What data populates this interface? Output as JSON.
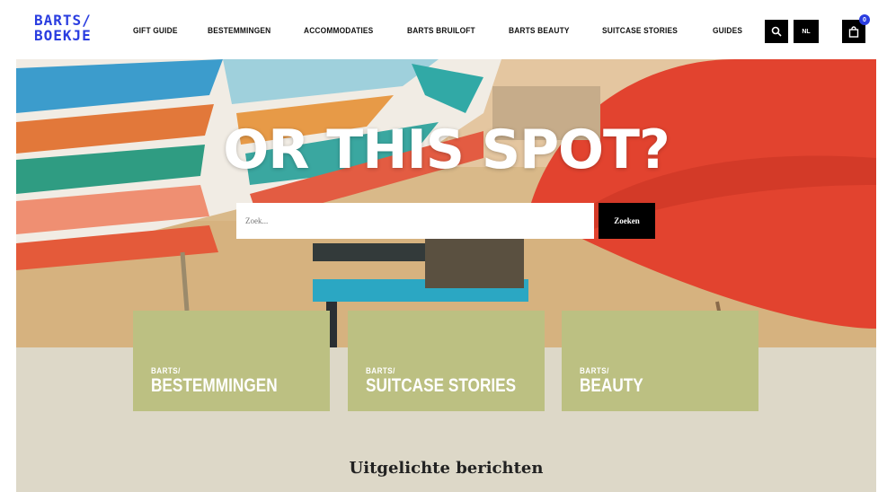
{
  "logo": {
    "line1": "BARTS/",
    "line2": "BOEKJE"
  },
  "nav": {
    "items": [
      "GIFT GUIDE",
      "BESTEMMINGEN",
      "ACCOMMODATIES",
      "BARTS BRUILOFT",
      "BARTS BEAUTY",
      "SUITCASE STORIES",
      "GUIDES"
    ],
    "lang_label": "NL",
    "cart_count": "0",
    "icons": {
      "search": "search-icon",
      "cart": "bag-icon"
    }
  },
  "hero": {
    "title": "OR THIS SPOT?",
    "search_placeholder": "Zoek...",
    "search_button": "Zoeken"
  },
  "tiles": [
    {
      "small": "BARTS/",
      "big": "BESTEMMINGEN"
    },
    {
      "small": "BARTS/",
      "big": "SUITCASE STORIES"
    },
    {
      "small": "BARTS/",
      "big": "BEAUTY"
    }
  ],
  "featured_heading": "Uitgelichte berichten",
  "colors": {
    "accent": "#2a3de0",
    "tile": "#bcc082",
    "section_bg": "#ddd8c8"
  }
}
